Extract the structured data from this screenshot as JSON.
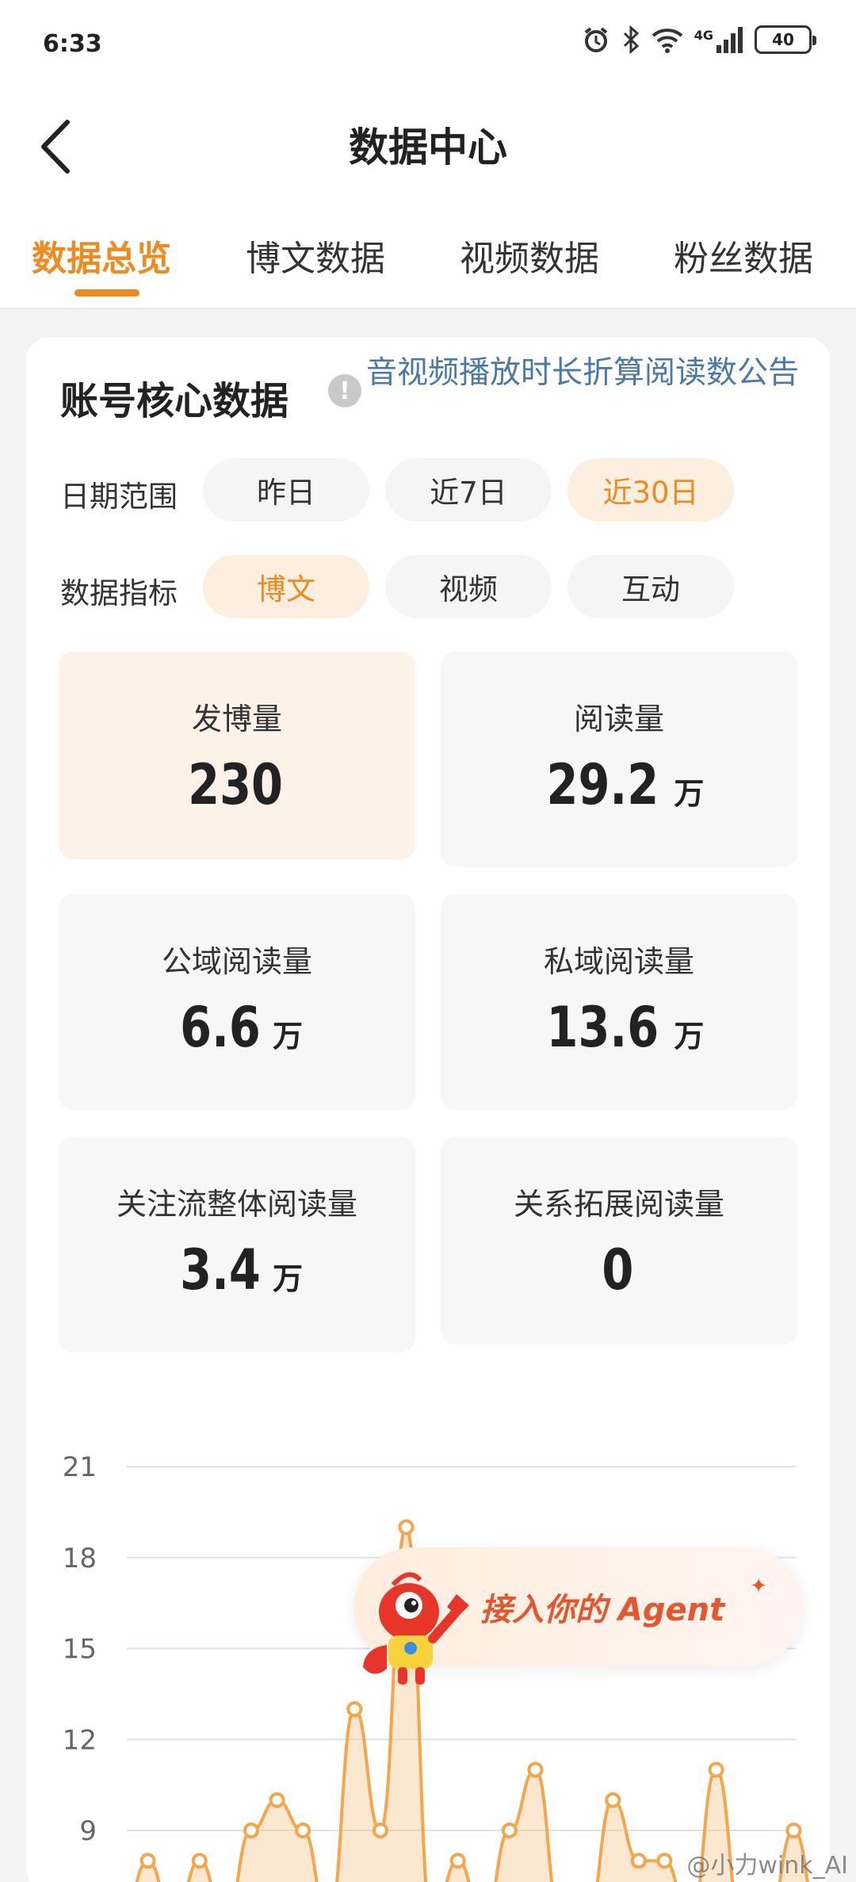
{
  "status_bar": {
    "time": "6:33",
    "signal_label": "4G",
    "battery": "40"
  },
  "header": {
    "title": "数据中心"
  },
  "tabs": [
    {
      "label": "数据总览",
      "active": true
    },
    {
      "label": "博文数据",
      "active": false
    },
    {
      "label": "视频数据",
      "active": false
    },
    {
      "label": "粉丝数据",
      "active": false
    }
  ],
  "core_data": {
    "title": "账号核心数据",
    "notice_link": "音视频播放时长折算阅读数公告",
    "date_range": {
      "label": "日期范围",
      "options": [
        "昨日",
        "近7日",
        "近30日"
      ],
      "selected": "近30日"
    },
    "metric": {
      "label": "数据指标",
      "options": [
        "博文",
        "视频",
        "互动"
      ],
      "selected": "博文"
    },
    "stats": [
      {
        "label": "发博量",
        "value": "230",
        "unit": ""
      },
      {
        "label": "阅读量",
        "value": "29.2",
        "unit": "万"
      },
      {
        "label": "公域阅读量",
        "value": "6.6",
        "unit": "万"
      },
      {
        "label": "私域阅读量",
        "value": "13.6",
        "unit": "万"
      },
      {
        "label": "关注流整体阅读量",
        "value": "3.4",
        "unit": "万"
      },
      {
        "label": "关系拓展阅读量",
        "value": "0",
        "unit": ""
      }
    ]
  },
  "chart_data": {
    "type": "area",
    "y_ticks": [
      "21",
      "18",
      "15",
      "12",
      "9"
    ],
    "ylim": [
      6,
      21
    ],
    "grid": true,
    "color": "#f5a64a",
    "series": [
      {
        "values": [
          6,
          8,
          6,
          8,
          6,
          9,
          10,
          9,
          6,
          13,
          9,
          19,
          6,
          8,
          6,
          9,
          11,
          6,
          6,
          10,
          8,
          8,
          6,
          11,
          6,
          6,
          9,
          6
        ]
      }
    ]
  },
  "agent_banner": {
    "text": "接入你的 Agent"
  },
  "watermark": "@小力wink_AI",
  "colors": {
    "accent": "#f08a1c",
    "link": "#4a79a8"
  }
}
